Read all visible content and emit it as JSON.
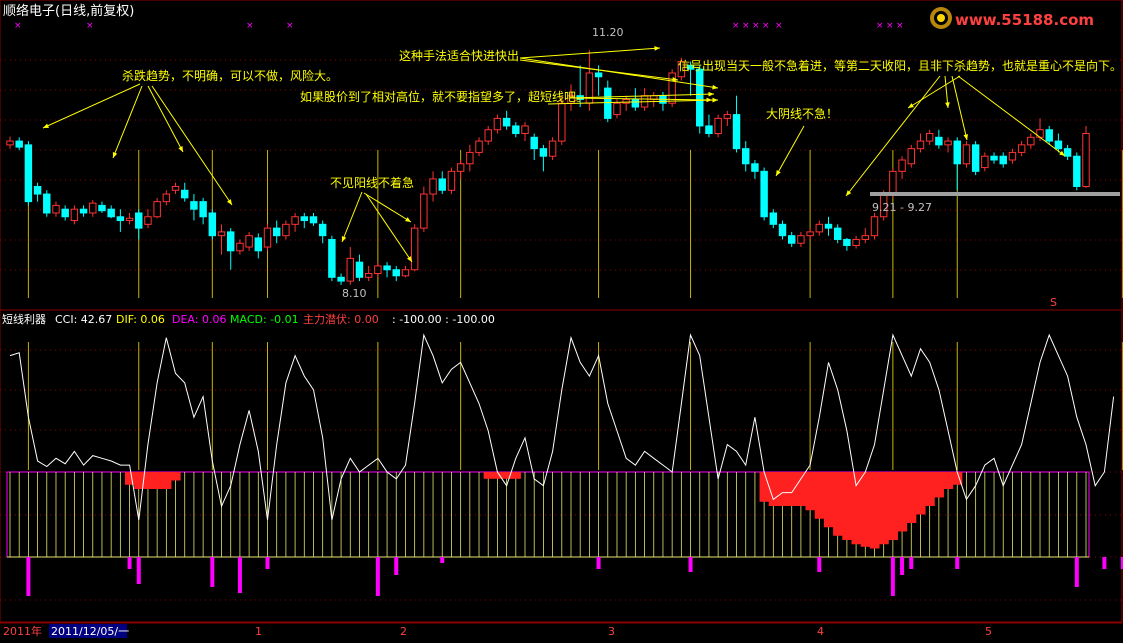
{
  "window": {
    "title": "顺络电子(日线,前复权)",
    "logo_text": "www.55188.com"
  },
  "colors": {
    "up": "#ff3232",
    "down": "#00ffff",
    "grid": "#8b0000",
    "annotation": "#ffff00",
    "cci_line": "#ffffff",
    "magenta": "#ff00ff"
  },
  "price_panel": {
    "high_label": "11.20",
    "low_label": "8.10",
    "range_label": "9.21 - 9.27",
    "s_marker": "S"
  },
  "annotations": [
    {
      "id": "a1",
      "text": "杀跌趋势，不明确，可以不做，风险大。"
    },
    {
      "id": "a2",
      "text": "不见阳线不着急"
    },
    {
      "id": "a3",
      "text": "这种手法适合快进快出"
    },
    {
      "id": "a4",
      "text": "如果股价到了相对高位，就不要指望多了，超短线吧。"
    },
    {
      "id": "a5",
      "text": "信号出现当天一般不急着进，等第二天收阳，且非下杀趋势，也就是重心不是向下。"
    },
    {
      "id": "a6",
      "text": "大阴线不急！"
    }
  ],
  "indicator_panel": {
    "name": "短线利器",
    "cci_label": "CCI: 42.67",
    "dif_label": "DIF: 0.06",
    "dea_label": "DEA: 0.06",
    "macd_label": "MACD: -0.01",
    "main_label": "主力潜伏: 0.00",
    "extra_label": ": -100.00 : -100.00"
  },
  "footer": {
    "year": "2011年",
    "date": "2011/12/05/一",
    "months": [
      "1",
      "2",
      "3",
      "4",
      "5"
    ]
  },
  "chart_data": {
    "type": "candlestick",
    "title": "顺络电子(日线,前复权)",
    "period": "daily",
    "candles": [
      [
        9.95,
        10.0,
        10.06,
        9.9
      ],
      [
        10.0,
        9.92,
        10.05,
        9.88
      ],
      [
        9.95,
        9.2,
        10.0,
        9.15
      ],
      [
        9.4,
        9.3,
        9.45,
        9.2
      ],
      [
        9.3,
        9.05,
        9.35,
        9.0
      ],
      [
        9.05,
        9.15,
        9.2,
        9.0
      ],
      [
        9.1,
        9.0,
        9.15,
        8.95
      ],
      [
        8.95,
        9.1,
        9.15,
        8.9
      ],
      [
        9.1,
        9.05,
        9.15,
        9.0
      ],
      [
        9.05,
        9.18,
        9.22,
        9.0
      ],
      [
        9.15,
        9.08,
        9.2,
        9.05
      ],
      [
        9.1,
        9.0,
        9.15,
        8.98
      ],
      [
        9.0,
        8.95,
        9.1,
        8.8
      ],
      [
        8.95,
        8.98,
        9.05,
        8.9
      ],
      [
        9.05,
        8.85,
        9.1,
        8.7
      ],
      [
        8.9,
        9.0,
        9.1,
        8.85
      ],
      [
        9.0,
        9.2,
        9.25,
        8.98
      ],
      [
        9.2,
        9.3,
        9.35,
        9.15
      ],
      [
        9.35,
        9.4,
        9.45,
        9.3
      ],
      [
        9.35,
        9.25,
        9.45,
        9.2
      ],
      [
        9.2,
        9.1,
        9.3,
        8.95
      ],
      [
        9.2,
        9.0,
        9.25,
        8.9
      ],
      [
        9.05,
        8.75,
        9.1,
        8.7
      ],
      [
        8.75,
        8.8,
        8.9,
        8.5
      ],
      [
        8.8,
        8.55,
        8.85,
        8.3
      ],
      [
        8.55,
        8.65,
        8.7,
        8.5
      ],
      [
        8.6,
        8.75,
        8.8,
        8.55
      ],
      [
        8.72,
        8.55,
        8.78,
        8.45
      ],
      [
        8.6,
        8.85,
        8.9,
        8.55
      ],
      [
        8.85,
        8.75,
        8.95,
        8.65
      ],
      [
        8.75,
        8.9,
        8.95,
        8.7
      ],
      [
        8.9,
        9.0,
        9.05,
        8.8
      ],
      [
        9.0,
        8.95,
        9.05,
        8.85
      ],
      [
        9.0,
        8.92,
        9.05,
        8.88
      ],
      [
        8.9,
        8.75,
        8.95,
        8.65
      ],
      [
        8.7,
        8.2,
        8.75,
        8.15
      ],
      [
        8.2,
        8.15,
        8.25,
        8.1
      ],
      [
        8.15,
        8.45,
        8.6,
        8.1
      ],
      [
        8.4,
        8.2,
        8.5,
        8.15
      ],
      [
        8.2,
        8.25,
        8.35,
        8.15
      ],
      [
        8.25,
        8.35,
        8.4,
        8.2
      ],
      [
        8.35,
        8.3,
        8.4,
        8.2
      ],
      [
        8.3,
        8.22,
        8.35,
        8.15
      ],
      [
        8.22,
        8.3,
        8.35,
        8.2
      ],
      [
        8.3,
        8.85,
        8.9,
        8.28
      ],
      [
        8.85,
        9.3,
        9.4,
        8.8
      ],
      [
        9.3,
        9.5,
        9.6,
        9.2
      ],
      [
        9.5,
        9.35,
        9.6,
        9.3
      ],
      [
        9.35,
        9.6,
        9.65,
        9.3
      ],
      [
        9.6,
        9.7,
        9.75,
        9.5
      ],
      [
        9.7,
        9.85,
        9.95,
        9.6
      ],
      [
        9.85,
        10.0,
        10.05,
        9.8
      ],
      [
        10.0,
        10.15,
        10.2,
        9.95
      ],
      [
        10.15,
        10.3,
        10.35,
        10.1
      ],
      [
        10.3,
        10.2,
        10.4,
        10.15
      ],
      [
        10.2,
        10.1,
        10.25,
        10.05
      ],
      [
        10.1,
        10.2,
        10.25,
        10.0
      ],
      [
        10.05,
        9.9,
        10.1,
        9.75
      ],
      [
        9.9,
        9.8,
        9.95,
        9.6
      ],
      [
        9.8,
        10.0,
        10.05,
        9.75
      ],
      [
        10.0,
        10.5,
        10.6,
        9.95
      ],
      [
        10.5,
        10.6,
        10.75,
        10.4
      ],
      [
        10.6,
        10.55,
        11.0,
        10.45
      ],
      [
        10.5,
        10.9,
        11.2,
        10.4
      ],
      [
        10.9,
        10.85,
        11.0,
        10.6
      ],
      [
        10.7,
        10.3,
        10.8,
        10.25
      ],
      [
        10.35,
        10.5,
        10.55,
        10.3
      ],
      [
        10.5,
        10.55,
        10.6,
        10.4
      ],
      [
        10.55,
        10.45,
        10.7,
        10.4
      ],
      [
        10.45,
        10.6,
        10.7,
        10.4
      ],
      [
        10.55,
        10.6,
        10.65,
        10.45
      ],
      [
        10.6,
        10.5,
        10.65,
        10.4
      ],
      [
        10.5,
        10.9,
        10.95,
        10.45
      ],
      [
        10.85,
        11.05,
        11.1,
        10.8
      ],
      [
        11.0,
        10.95,
        11.05,
        10.6
      ],
      [
        10.95,
        10.2,
        11.0,
        10.1
      ],
      [
        10.2,
        10.1,
        10.35,
        10.05
      ],
      [
        10.1,
        10.3,
        10.35,
        10.05
      ],
      [
        10.3,
        10.35,
        10.4,
        10.2
      ],
      [
        10.35,
        9.9,
        10.6,
        9.85
      ],
      [
        9.9,
        9.7,
        10.0,
        9.6
      ],
      [
        9.7,
        9.6,
        9.75,
        9.5
      ],
      [
        9.6,
        9.0,
        9.65,
        8.95
      ],
      [
        9.05,
        8.9,
        9.1,
        8.85
      ],
      [
        8.9,
        8.75,
        8.95,
        8.7
      ],
      [
        8.75,
        8.65,
        8.8,
        8.6
      ],
      [
        8.65,
        8.75,
        8.8,
        8.6
      ],
      [
        8.75,
        8.8,
        8.85,
        8.7
      ],
      [
        8.8,
        8.9,
        8.95,
        8.75
      ],
      [
        8.9,
        8.85,
        9.0,
        8.75
      ],
      [
        8.85,
        8.7,
        8.9,
        8.65
      ],
      [
        8.7,
        8.62,
        8.72,
        8.55
      ],
      [
        8.62,
        8.7,
        8.75,
        8.58
      ],
      [
        8.7,
        8.75,
        8.85,
        8.65
      ],
      [
        8.75,
        9.0,
        9.05,
        8.7
      ],
      [
        9.0,
        9.3,
        9.35,
        8.95
      ],
      [
        9.3,
        9.6,
        9.65,
        9.25
      ],
      [
        9.6,
        9.75,
        9.8,
        9.5
      ],
      [
        9.7,
        9.9,
        9.95,
        9.65
      ],
      [
        9.9,
        10.0,
        10.1,
        9.85
      ],
      [
        10.0,
        10.1,
        10.15,
        9.95
      ],
      [
        10.05,
        9.95,
        10.15,
        9.9
      ],
      [
        9.95,
        10.0,
        10.05,
        9.85
      ],
      [
        10.0,
        9.7,
        10.05,
        9.35
      ],
      [
        9.7,
        9.95,
        10.0,
        9.65
      ],
      [
        9.95,
        9.6,
        10.0,
        9.55
      ],
      [
        9.65,
        9.8,
        9.85,
        9.6
      ],
      [
        9.8,
        9.75,
        9.85,
        9.7
      ],
      [
        9.8,
        9.7,
        9.85,
        9.65
      ],
      [
        9.75,
        9.85,
        9.9,
        9.7
      ],
      [
        9.85,
        9.95,
        10.0,
        9.8
      ],
      [
        9.95,
        10.05,
        10.1,
        9.9
      ],
      [
        10.05,
        10.15,
        10.3,
        10.0
      ],
      [
        10.15,
        10.0,
        10.2,
        9.95
      ],
      [
        10.0,
        9.9,
        10.1,
        9.85
      ],
      [
        9.9,
        9.8,
        9.95,
        9.75
      ],
      [
        9.8,
        9.4,
        9.85,
        9.35
      ],
      [
        9.4,
        10.1,
        10.2,
        9.38
      ]
    ],
    "cci": [
      0.85,
      0.87,
      0.4,
      0.08,
      0.04,
      0.1,
      0.06,
      0.15,
      0.05,
      0.12,
      0.1,
      0.08,
      0.05,
      0.05,
      -0.35,
      0.2,
      0.65,
      0.98,
      0.72,
      0.65,
      0.4,
      0.55,
      0.08,
      -0.25,
      -0.1,
      0.2,
      0.45,
      0.15,
      -0.35,
      0.2,
      0.65,
      0.85,
      0.7,
      0.6,
      0.25,
      -0.35,
      -0.05,
      0.1,
      0.0,
      0.05,
      0.1,
      0.0,
      -0.05,
      0.05,
      0.5,
      1.0,
      0.85,
      0.65,
      0.75,
      0.8,
      0.65,
      0.5,
      0.3,
      0.0,
      -0.1,
      0.1,
      0.25,
      -0.05,
      -0.1,
      0.15,
      0.6,
      0.98,
      0.8,
      0.7,
      0.85,
      0.5,
      0.3,
      0.1,
      0.05,
      0.15,
      0.1,
      0.05,
      0.0,
      0.5,
      1.0,
      0.85,
      0.4,
      -0.05,
      0.2,
      0.15,
      0.05,
      0.4,
      0.0,
      -0.2,
      -0.15,
      -0.15,
      -0.05,
      0.05,
      0.4,
      0.8,
      0.6,
      0.3,
      -0.1,
      0.0,
      0.2,
      0.6,
      1.0,
      0.85,
      0.7,
      0.9,
      0.8,
      0.6,
      0.3,
      0.0,
      -0.2,
      -0.1,
      0.05,
      0.1,
      -0.1,
      0.05,
      0.2,
      0.5,
      0.8,
      1.0,
      0.85,
      0.7,
      0.4,
      0.2,
      -0.1,
      0.0,
      0.55
    ],
    "zero_line": 0,
    "main_bars": [
      {
        "from": 13,
        "to": 18,
        "values": [
          0.15,
          0.2,
          0.2,
          0.2,
          0.2,
          0.1
        ]
      },
      {
        "from": 52,
        "to": 55,
        "values": [
          0.08,
          0.08,
          0.08,
          0.08
        ]
      },
      {
        "from": 82,
        "to": 103,
        "values": [
          0.35,
          0.4,
          0.4,
          0.4,
          0.4,
          0.45,
          0.55,
          0.65,
          0.75,
          0.8,
          0.85,
          0.88,
          0.9,
          0.85,
          0.8,
          0.7,
          0.6,
          0.5,
          0.4,
          0.3,
          0.2,
          0.15
        ]
      }
    ],
    "magenta_down_bars": [
      {
        "index": 2,
        "value": 0.65
      },
      {
        "index": 13,
        "value": 0.2
      },
      {
        "index": 14,
        "value": 0.45
      },
      {
        "index": 22,
        "value": 0.5
      },
      {
        "index": 25,
        "value": 0.6
      },
      {
        "index": 28,
        "value": 0.2
      },
      {
        "index": 40,
        "value": 0.65
      },
      {
        "index": 42,
        "value": 0.3
      },
      {
        "index": 47,
        "value": 0.1
      },
      {
        "index": 64,
        "value": 0.2
      },
      {
        "index": 74,
        "value": 0.25
      },
      {
        "index": 88,
        "value": 0.25
      },
      {
        "index": 96,
        "value": 0.65
      },
      {
        "index": 97,
        "value": 0.3
      },
      {
        "index": 98,
        "value": 0.2
      },
      {
        "index": 103,
        "value": 0.2
      },
      {
        "index": 116,
        "value": 0.5
      },
      {
        "index": 119,
        "value": 0.2
      },
      {
        "index": 121,
        "value": 0.2
      },
      {
        "index": 126,
        "value": 0.2
      },
      {
        "index": 131,
        "value": 0.2
      },
      {
        "index": 133,
        "value": 0.2
      },
      {
        "index": 135,
        "value": 0.5
      }
    ],
    "signal_days": [
      2,
      14,
      22,
      28,
      40,
      49,
      64,
      74,
      87,
      96,
      103,
      121,
      130,
      135
    ]
  }
}
